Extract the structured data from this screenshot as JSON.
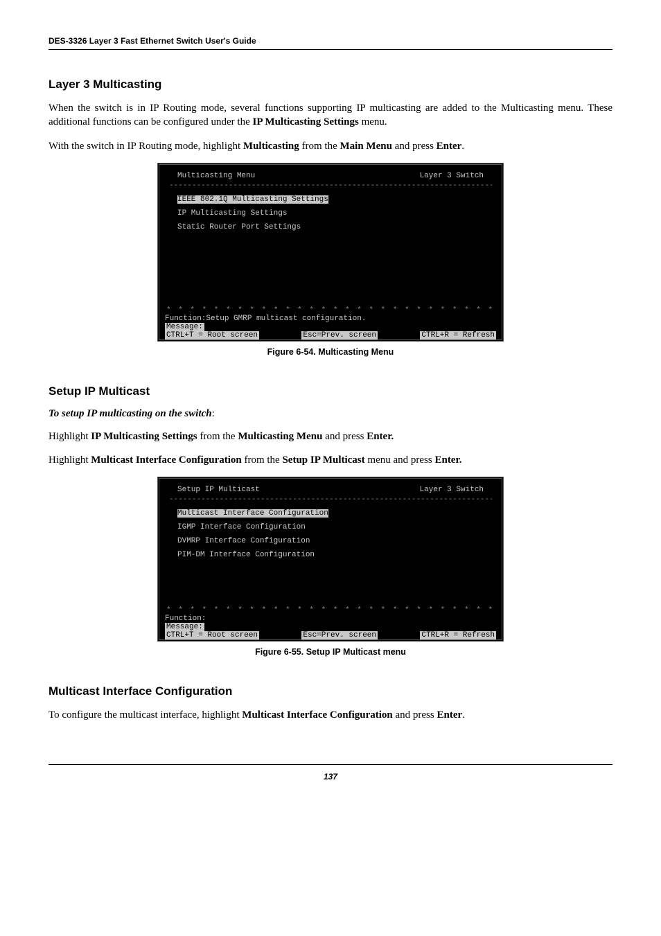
{
  "header": {
    "title": "DES-3326 Layer 3 Fast Ethernet Switch User's Guide"
  },
  "sections": {
    "layer3": {
      "heading": "Layer 3 Multicasting",
      "para1_a": "When the switch is in IP Routing mode, several functions supporting IP multicasting are added to the Multicasting menu. These additional functions can be configured under the ",
      "para1_bold": "IP Multicasting Settings",
      "para1_b": " menu.",
      "para2_a": "With the switch in IP Routing mode, highlight ",
      "para2_bold1": "Multicasting",
      "para2_b": " from the ",
      "para2_bold2": "Main Menu",
      "para2_c": " and press ",
      "para2_bold3": "Enter",
      "para2_d": "."
    },
    "setup": {
      "heading": "Setup IP Multicast",
      "subhead_italic": "To setup IP multicasting on the switch",
      "subhead_tail": ":",
      "para1_a": "Highlight ",
      "para1_bold1": "IP Multicasting Settings",
      "para1_b": " from the ",
      "para1_bold2": "Multicasting Menu",
      "para1_c": " and press ",
      "para1_bold3": "Enter.",
      "para2_a": "Highlight ",
      "para2_bold1": "Multicast Interface Configuration",
      "para2_b": " from the ",
      "para2_bold2": "Setup IP Multicast",
      "para2_c": " menu and press ",
      "para2_bold3": "Enter."
    },
    "mic": {
      "heading": "Multicast Interface Configuration",
      "para1_a": "To configure the multicast interface, highlight ",
      "para1_bold1": "Multicast Interface Configuration",
      "para1_b": " and press ",
      "para1_bold2": "Enter",
      "para1_c": "."
    }
  },
  "console1": {
    "title": "Multicasting Menu",
    "mode": "Layer 3 Switch",
    "divider": "---------------------------------------------------------------------------------",
    "items": {
      "i0": "IEEE 802.1Q Multicasting Settings",
      "i1": "IP Multicasting Settings",
      "i2": "Static Router Port Settings"
    },
    "sep": "* * * * * * * * * * * * * * * * * * * * * * * * * * * * * * * * * * * * * * * * *",
    "function": "Function:Setup GMRP multicast configuration.",
    "message": "Message:",
    "footer": {
      "left": "CTRL+T = Root screen",
      "center": "Esc=Prev. screen",
      "right": "CTRL+R = Refresh"
    }
  },
  "console2": {
    "title": "Setup IP Multicast",
    "mode": "Layer 3 Switch",
    "divider": "---------------------------------------------------------------------------------",
    "items": {
      "i0": "Multicast Interface Configuration",
      "i1": "IGMP Interface Configuration",
      "i2": "DVMRP Interface Configuration",
      "i3": "PIM-DM Interface Configuration"
    },
    "sep": "* * * * * * * * * * * * * * * * * * * * * * * * * * * * * * * * * * * * * * * * *",
    "function": "Function:",
    "message": "Message:",
    "footer": {
      "left": "CTRL+T = Root screen",
      "center": "Esc=Prev. screen",
      "right": "CTRL+R = Refresh"
    }
  },
  "captions": {
    "fig1": "Figure 6-54.  Multicasting Menu",
    "fig2": "Figure 6-55.  Setup IP Multicast menu"
  },
  "page_number": "137"
}
